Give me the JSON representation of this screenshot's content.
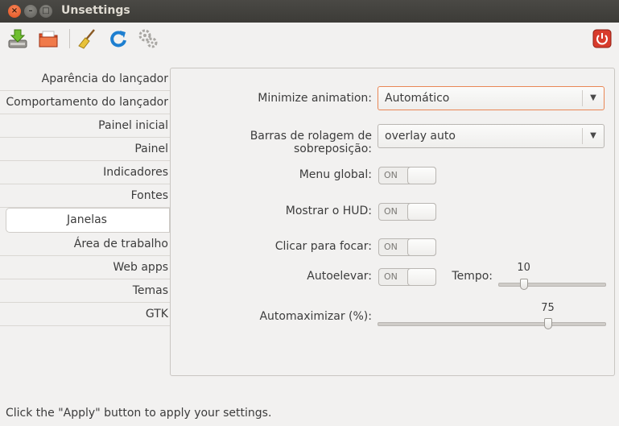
{
  "window": {
    "title": "Unsettings",
    "close_glyph": "×",
    "min_glyph": "–",
    "max_glyph": "□"
  },
  "toolbar": {
    "icons": [
      "save-download-icon",
      "open-folder-icon",
      "broom-clean-icon",
      "refresh-icon",
      "settings-gears-icon",
      "power-icon"
    ]
  },
  "sidebar": {
    "items": [
      {
        "label": "Aparência do lançador"
      },
      {
        "label": "Comportamento do lançador"
      },
      {
        "label": "Painel inicial"
      },
      {
        "label": "Painel"
      },
      {
        "label": "Indicadores"
      },
      {
        "label": "Fontes"
      },
      {
        "label": "Janelas"
      },
      {
        "label": "Área de trabalho"
      },
      {
        "label": "Web apps"
      },
      {
        "label": "Temas"
      },
      {
        "label": "GTK"
      }
    ],
    "selected": "Janelas"
  },
  "janelas": {
    "minimize_label": "Minimize animation:",
    "minimize_value": "Automático",
    "scrollbars_label": "Barras de rolagem de sobreposição:",
    "scrollbars_value": "overlay auto",
    "menu_global_label": "Menu global:",
    "hud_label": "Mostrar o HUD:",
    "click_focus_label": "Clicar para focar:",
    "autoraise_label": "Autoelevar:",
    "tempo_label": "Tempo:",
    "tempo_value": 10,
    "tempo_fraction": 0.24,
    "automax_label": "Automaximizar (%):",
    "automax_value": 75,
    "automax_percent": 75,
    "switch_on": "ON",
    "combo_arrow": "▼"
  },
  "status": {
    "text": "Click the \"Apply\" button to apply your settings."
  },
  "colors": {
    "accent": "#e98755",
    "power": "#d83b2c",
    "refresh": "#1e7fd0"
  }
}
